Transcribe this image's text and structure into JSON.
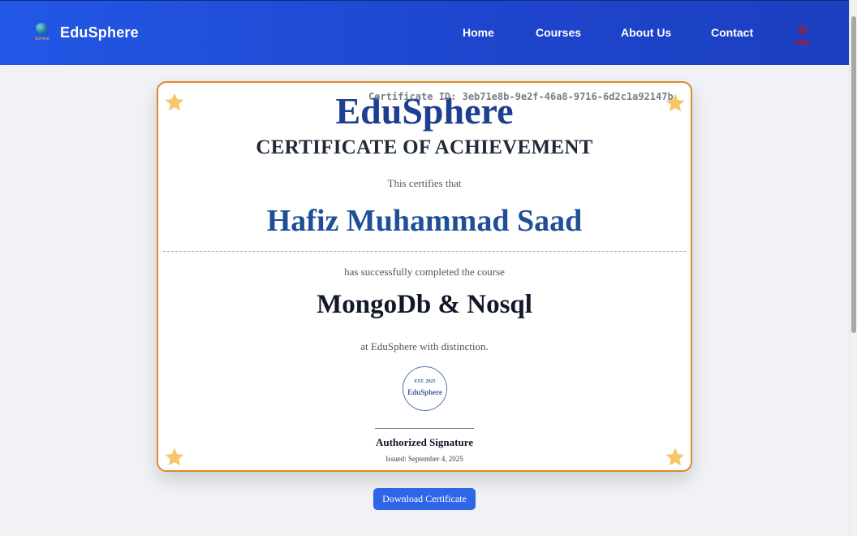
{
  "nav": {
    "brand": "EduSphere",
    "logo_text": "Sphere",
    "links": [
      "Home",
      "Courses",
      "About Us",
      "Contact"
    ]
  },
  "certificate": {
    "title": "EduSphere",
    "id_text": "Certificate ID: 3eb71e8b-9e2f-46a8-9716-6d2c1a92147b",
    "heading": "CERTIFICATE OF ACHIEVEMENT",
    "certifies": "This certifies that",
    "recipient": "Hafiz Muhammad Saad",
    "completed": "has successfully completed the course",
    "course": "MongoDb & Nosql",
    "distinction": "at EduSphere with distinction.",
    "seal": {
      "est": "EST. 2025",
      "name": "EduSphere"
    },
    "signature_label": "Authorized Signature",
    "issued": "Issued: September 4, 2025"
  },
  "download_label": "Download Certificate",
  "colors": {
    "nav_gradient_start": "#2357e6",
    "nav_gradient_end": "#1c3fc0",
    "cert_border": "#e0892a",
    "star": "#f8c56a",
    "title": "#1c3f8f",
    "recipient": "#1f4f96",
    "button": "#2f66e8"
  }
}
